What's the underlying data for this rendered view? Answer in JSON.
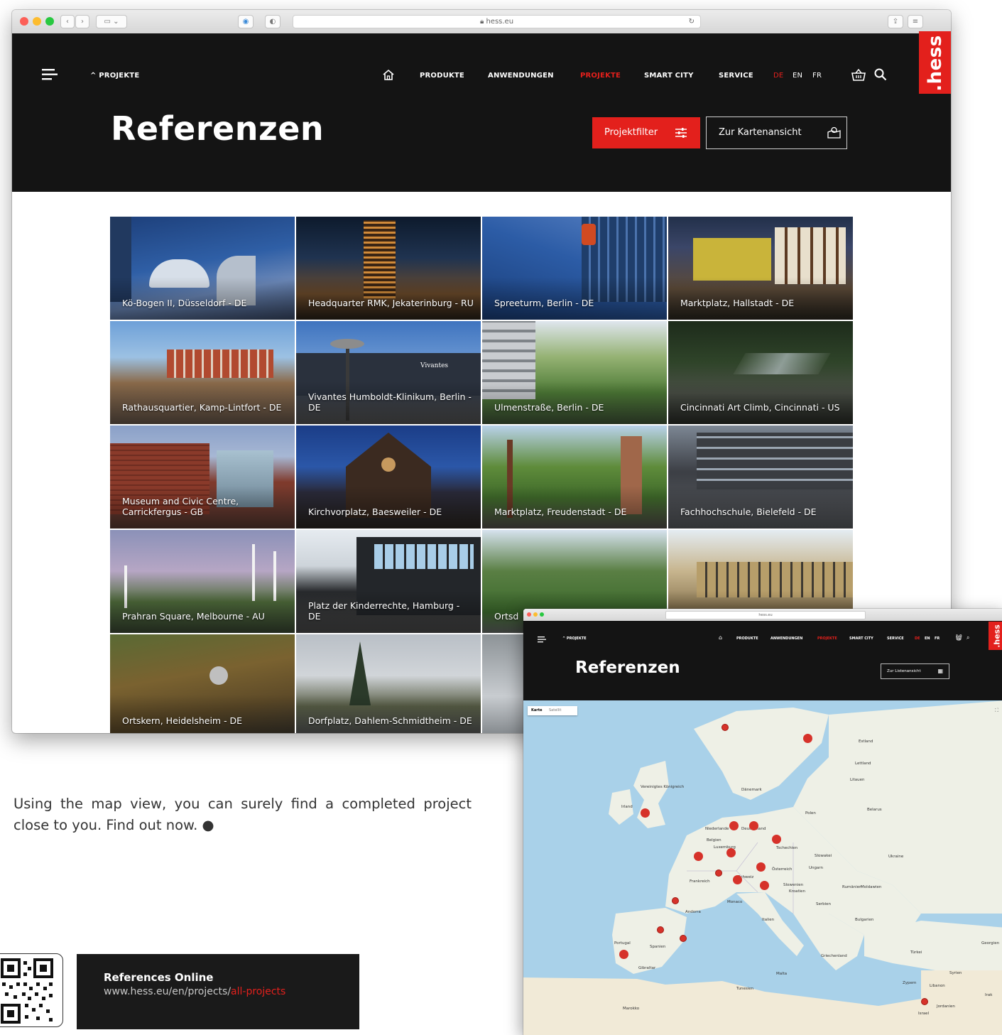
{
  "browser": {
    "url": "hess.eu"
  },
  "header": {
    "breadcrumb": "^ PROJEKTE",
    "nav": [
      "PRODUKTE",
      "ANWENDUNGEN",
      "PROJEKTE",
      "SMART CITY",
      "SERVICE"
    ],
    "active_nav": "PROJEKTE",
    "languages": [
      "DE",
      "EN",
      "FR"
    ],
    "active_language": "DE",
    "logo": ".hess"
  },
  "page": {
    "title": "Referenzen",
    "filter_button": "Projektfilter",
    "map_button": "Zur Kartenansicht"
  },
  "projects": [
    "Kö-Bogen II, Düsseldorf - DE",
    "Headquarter RMK, Jekaterinburg - RU",
    "Spreeturm, Berlin - DE",
    "Marktplatz, Hallstadt - DE",
    "Rathausquartier, Kamp-Lintfort - DE",
    "Vivantes Humboldt-Klinikum, Berlin - DE",
    "Ulmenstraße, Berlin - DE",
    "Cincinnati Art Climb, Cincinnati - US",
    "Museum and Civic Centre, Carrickfergus - GB",
    "Kirchvorplatz, Baesweiler - DE",
    "Marktplatz, Freudenstadt - DE",
    "Fachhochschule, Bielefeld - DE",
    "Prahran Square, Melbourne - AU",
    "Platz der Kinderrechte, Hamburg - DE",
    "Ortsd",
    "",
    "Ortskern, Heidelsheim - DE",
    "Dorfplatz, Dahlem-Schmidtheim - DE"
  ],
  "map_window": {
    "title": "Referenzen",
    "list_button": "Zur Listenansicht",
    "map_tabs": [
      "Karte",
      "Satellit"
    ],
    "countries": [
      "Vereinigtes Königreich",
      "Irland",
      "Dänemark",
      "Niederlande",
      "Deutschland",
      "Belgien",
      "Luxemburg",
      "Polen",
      "Tschechien",
      "Slowakei",
      "Österreich",
      "Ungarn",
      "Schweiz",
      "Frankreich",
      "Slowenien",
      "Kroatien",
      "Rumänien",
      "Serbien",
      "Italien",
      "Bulgarien",
      "Spanien",
      "Portugal",
      "Griechenland",
      "Türkei",
      "Ukraine",
      "Belarus",
      "Litauen",
      "Lettland",
      "Estland",
      "Monaco",
      "Andorra",
      "Gibraltar",
      "Tunesien",
      "Malta",
      "Marokko",
      "Libanon",
      "Israel",
      "Jordanien",
      "Zypern",
      "Syrien",
      "Irak",
      "Georgien",
      "Moldawien"
    ]
  },
  "description": "Using the map view, you can surely find a completed project close to you. Find out now. ●",
  "references": {
    "title": "References Online",
    "url_prefix": "www.hess.eu/en/projects/",
    "url_highlight": "all-projects"
  }
}
